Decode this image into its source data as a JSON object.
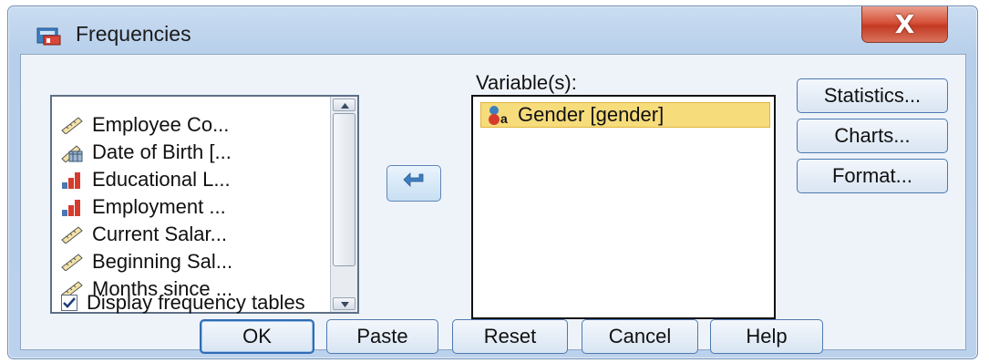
{
  "window": {
    "title": "Frequencies",
    "close_label": "X"
  },
  "source_list": {
    "items": [
      {
        "label": "Employee Co...",
        "icon": "ruler-icon"
      },
      {
        "label": "Date of Birth [...",
        "icon": "calendar-scale-icon"
      },
      {
        "label": "Educational L...",
        "icon": "ordinal-bar-icon"
      },
      {
        "label": "Employment ...",
        "icon": "ordinal-bar-icon"
      },
      {
        "label": "Current Salar...",
        "icon": "ruler-icon"
      },
      {
        "label": "Beginning Sal...",
        "icon": "ruler-icon"
      },
      {
        "label": "Months since ...",
        "icon": "ruler-icon"
      }
    ]
  },
  "target": {
    "label": "Variable(s):",
    "items": [
      {
        "label": "Gender [gender]",
        "icon": "nominal-icon"
      }
    ]
  },
  "side_buttons": {
    "statistics": "Statistics...",
    "charts": "Charts...",
    "format": "Format..."
  },
  "checkbox": {
    "label": "Display frequency tables",
    "checked": true
  },
  "buttons": {
    "ok": "OK",
    "paste": "Paste",
    "reset": "Reset",
    "cancel": "Cancel",
    "help": "Help"
  },
  "colors": {
    "selection": "#f6dc7b",
    "accent": "#4d79b0",
    "close": "#c33a23"
  }
}
